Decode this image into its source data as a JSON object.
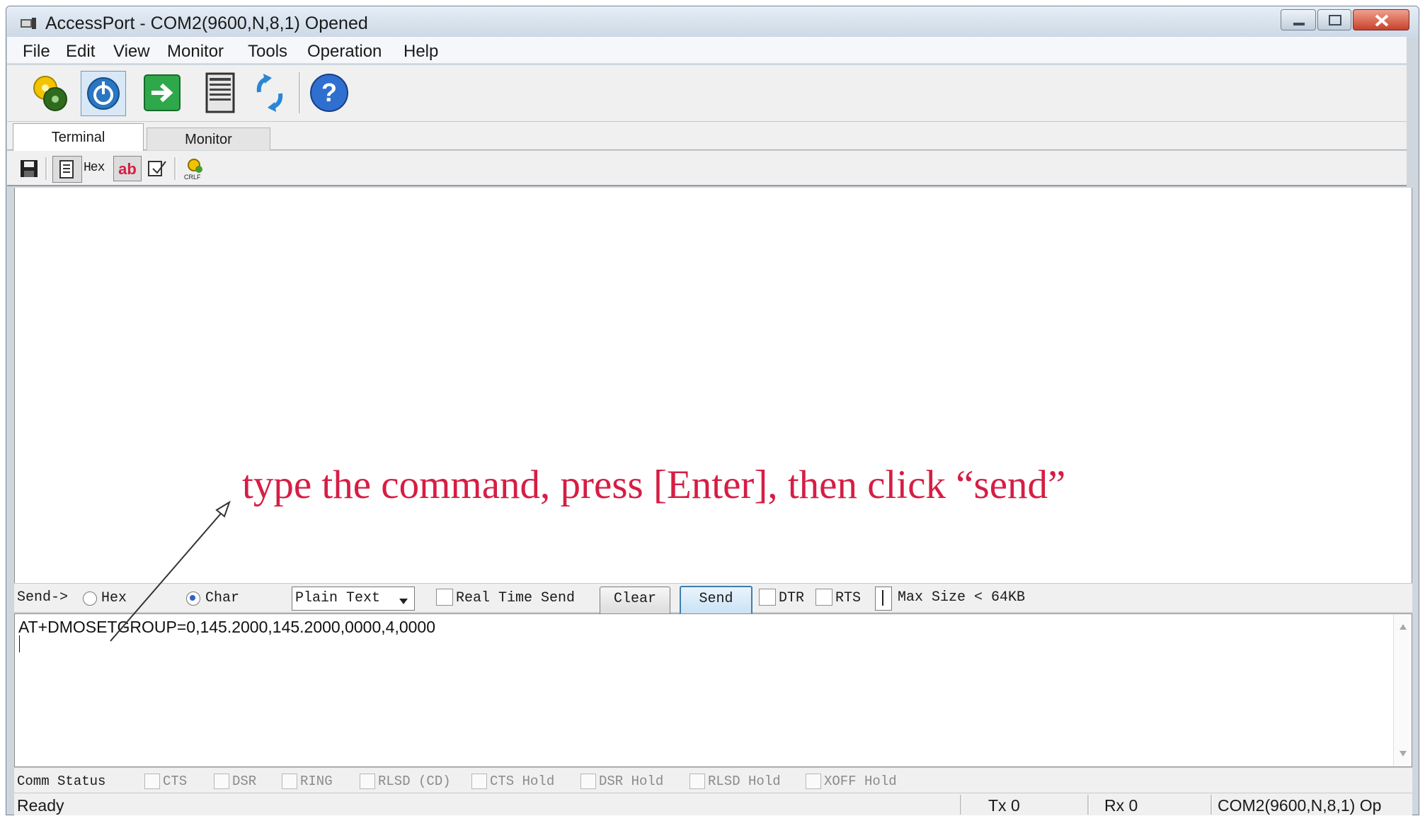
{
  "window": {
    "title": "AccessPort - COM2(9600,N,8,1) Opened",
    "controls": [
      "minimize",
      "maximize",
      "close"
    ]
  },
  "menu": {
    "items": [
      "File",
      "Edit",
      "View",
      "Monitor",
      "Tools",
      "Operation",
      "Help"
    ]
  },
  "toolbar": {
    "icons": [
      "settings-icon",
      "power-icon",
      "enter-icon",
      "document-icon",
      "refresh-icon",
      "help-icon"
    ]
  },
  "tabs": [
    {
      "label": "Terminal",
      "active": true
    },
    {
      "label": "Monitor",
      "active": false
    }
  ],
  "small_toolbar": {
    "hex_label": "Hex",
    "ab_label": "ab",
    "crlf_label": "CRLF"
  },
  "annotation": {
    "text": "type the command, press [Enter], then click “send”",
    "color": "#d51e44"
  },
  "send_bar": {
    "label": "Send->",
    "hex_label": "Hex",
    "char_label": "Char",
    "mode_selected": "Char",
    "format_value": "Plain Text",
    "real_time_label": "Real Time Send",
    "clear_label": "Clear",
    "send_label": "Send",
    "dtr_label": "DTR",
    "rts_label": "RTS",
    "max_size_label": "Max Size < 64KB"
  },
  "send_input": {
    "value": "AT+DMOSETGROUP=0,145.2000,145.2000,0000,4,0000"
  },
  "comm_status": {
    "label": "Comm Status",
    "items": [
      "CTS",
      "DSR",
      "RING",
      "RLSD (CD)",
      "CTS Hold",
      "DSR Hold",
      "RLSD Hold",
      "XOFF Hold"
    ]
  },
  "status_bar": {
    "state": "Ready",
    "tx": "Tx 0",
    "rx": "Rx 0",
    "port": "COM2(9600,N,8,1) Op"
  }
}
